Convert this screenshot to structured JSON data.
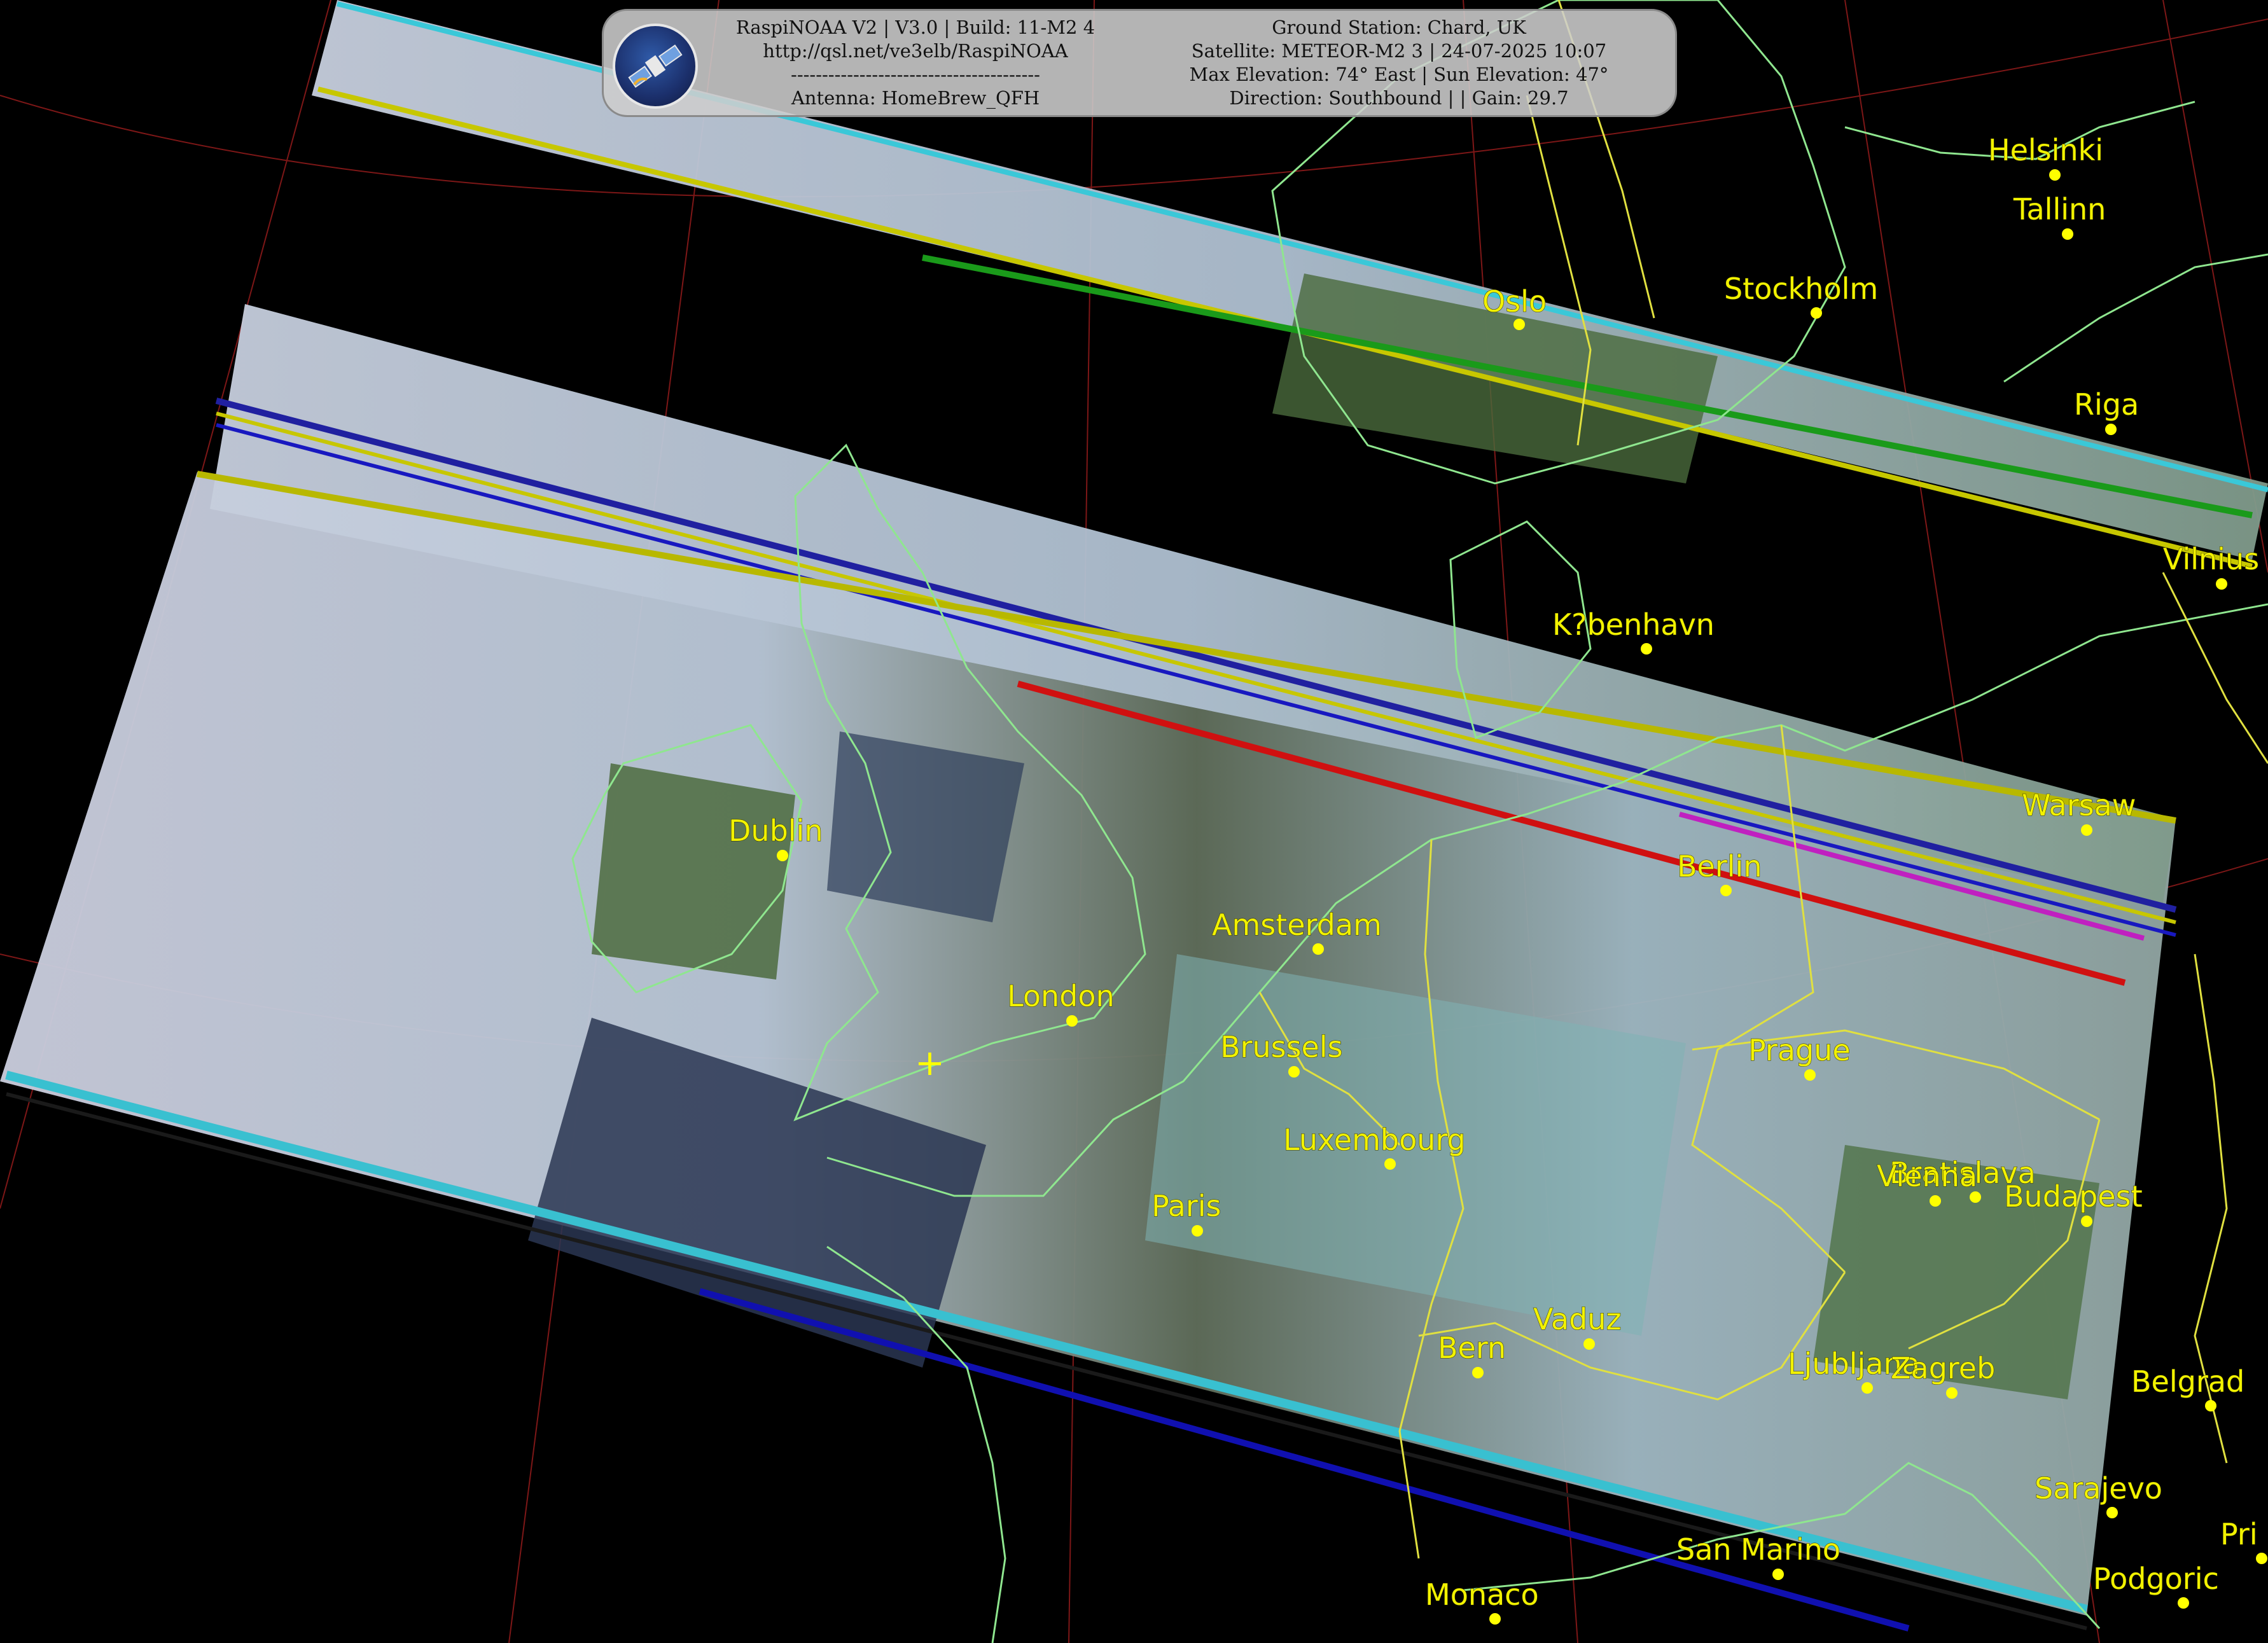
{
  "banner": {
    "left_lines": [
      "RaspiNOAA V2 | V3.0 | Build: 11-M2 4",
      "http://qsl.net/ve3elb/RaspiNOAA",
      "----------------------------------------",
      "Antenna: HomeBrew_QFH"
    ],
    "right_lines": [
      "Ground Station: Chard, UK",
      "Satellite: METEOR-M2 3 | 24-07-2025 10:07",
      "Max Elevation: 74° East | Sun Elevation: 47°",
      "Direction: Southbound | | Gain: 29.7"
    ],
    "logo_icon": "satellite-icon"
  },
  "cities": [
    {
      "id": "helsinki",
      "name": "Helsinki"
    },
    {
      "id": "tallinn",
      "name": "Tallinn"
    },
    {
      "id": "stockholm",
      "name": "Stockholm"
    },
    {
      "id": "oslo",
      "name": "Oslo"
    },
    {
      "id": "riga",
      "name": "Riga"
    },
    {
      "id": "vilnius",
      "name": "Vilnius"
    },
    {
      "id": "kobenhavn",
      "name": "K?benhavn"
    },
    {
      "id": "warsaw",
      "name": "Warsaw"
    },
    {
      "id": "berlin",
      "name": "Berlin"
    },
    {
      "id": "dublin",
      "name": "Dublin"
    },
    {
      "id": "amsterdam",
      "name": "Amsterdam"
    },
    {
      "id": "london",
      "name": "London"
    },
    {
      "id": "brussels",
      "name": "Brussels"
    },
    {
      "id": "prague",
      "name": "Prague"
    },
    {
      "id": "luxembourg",
      "name": "Luxembourg"
    },
    {
      "id": "paris",
      "name": "Paris"
    },
    {
      "id": "bratislava",
      "name": "Bratislava"
    },
    {
      "id": "vienna",
      "name": "Vienna"
    },
    {
      "id": "budapest",
      "name": "Budapest"
    },
    {
      "id": "vaduz",
      "name": "Vaduz"
    },
    {
      "id": "bern",
      "name": "Bern"
    },
    {
      "id": "ljubljana",
      "name": "Ljubljana"
    },
    {
      "id": "zagreb",
      "name": "Zagreb"
    },
    {
      "id": "belgrade",
      "name": "Belgrad"
    },
    {
      "id": "sarajevo",
      "name": "Sarajevo"
    },
    {
      "id": "pristina",
      "name": "Pri"
    },
    {
      "id": "san-marino",
      "name": "San Marino"
    },
    {
      "id": "podgorica",
      "name": "Podgoric"
    },
    {
      "id": "monaco",
      "name": "Monaco"
    }
  ],
  "colors": {
    "city": "#ffff00",
    "coastline": "#8fe68f",
    "border": "#e0e040",
    "graticule": "#8b1a1a"
  },
  "ground_station_marker": "+"
}
